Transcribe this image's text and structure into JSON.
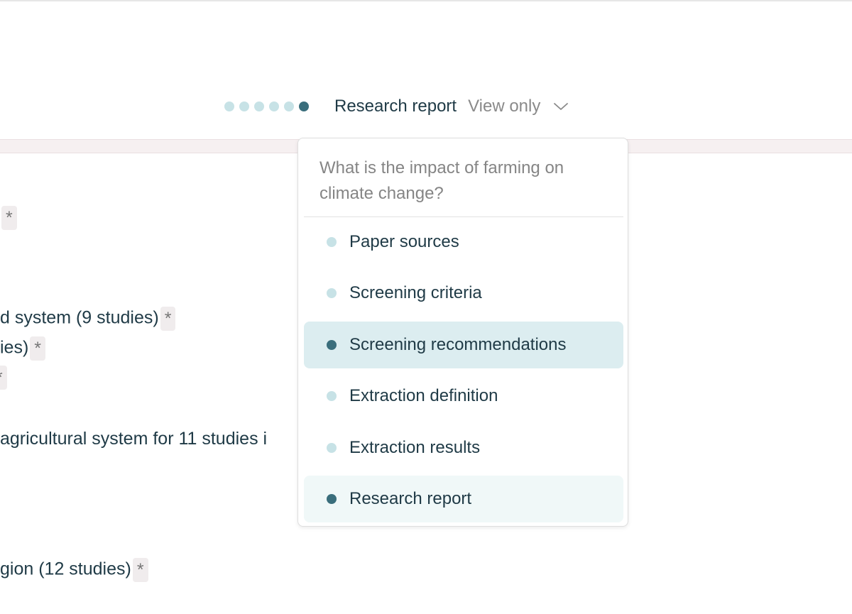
{
  "header": {
    "steps_total": 6,
    "current_step": 6,
    "title": "Research report",
    "mode": "View only"
  },
  "background": {
    "lines": [
      {
        "text": "",
        "star": "*"
      },
      {
        "text": "d system (9 studies)",
        "star": "*"
      },
      {
        "text": "ies)",
        "star": "*"
      },
      {
        "text": "",
        "star": "*"
      },
      {
        "text": " agricultural system for 11 studies i",
        "star": ""
      },
      {
        "text": "gion (12 studies)",
        "star": "*"
      }
    ]
  },
  "dropdown": {
    "question": "What is the impact of farming on climate change?",
    "items": [
      {
        "label": "Paper sources",
        "state": "normal"
      },
      {
        "label": "Screening criteria",
        "state": "normal"
      },
      {
        "label": "Screening recommendations",
        "state": "hover"
      },
      {
        "label": "Extraction definition",
        "state": "normal"
      },
      {
        "label": "Extraction results",
        "state": "normal"
      },
      {
        "label": "Research report",
        "state": "current"
      }
    ]
  },
  "colors": {
    "accent_dark": "#3a6e7c",
    "accent_light": "#c7e2e6",
    "hover_bg": "#dcedf0",
    "current_bg": "#f0f8f8"
  }
}
